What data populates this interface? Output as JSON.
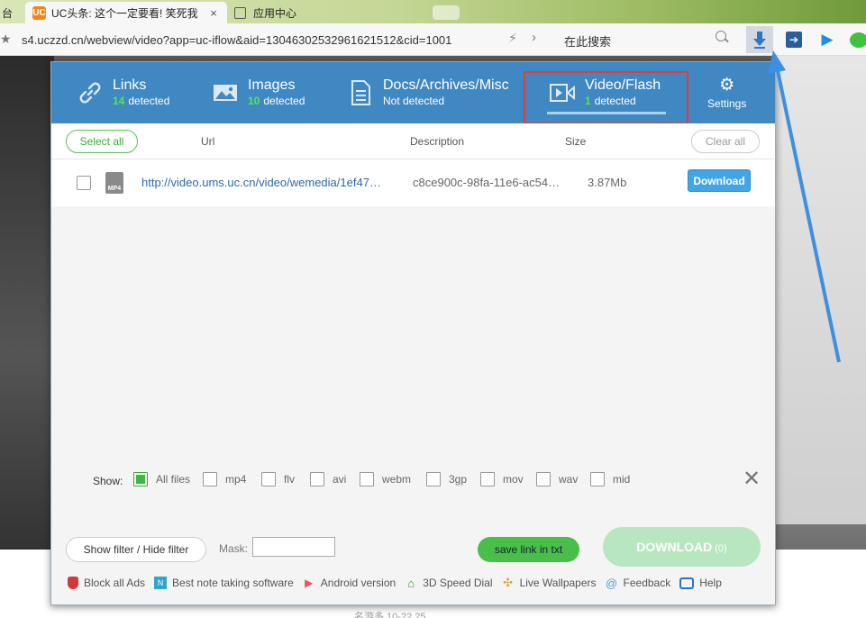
{
  "browser": {
    "tabs": [
      {
        "title": "台"
      },
      {
        "title": "UC头条: 这个一定要看! 笑死我",
        "close": "×"
      },
      {
        "title": "应用中心"
      }
    ],
    "url": "s4.uczzd.cn/webview/video?app=uc-iflow&aid=13046302532961621512&cid=1001",
    "search_placeholder": "在此搜索",
    "favicon_text": "UC"
  },
  "panel": {
    "tabs": {
      "links": {
        "label": "Links",
        "count": "14",
        "suffix": "detected"
      },
      "images": {
        "label": "Images",
        "count": "10",
        "suffix": "detected"
      },
      "docs": {
        "label": "Docs/Archives/Misc",
        "status": "Not detected"
      },
      "video": {
        "label": "Video/Flash",
        "count": "1",
        "suffix": "detected"
      },
      "settings": {
        "label": "Settings"
      }
    },
    "columns": {
      "select_all": "Select all",
      "url": "Url",
      "description": "Description",
      "size": "Size",
      "clear_all": "Clear all"
    },
    "rows": [
      {
        "type": "MP4",
        "url": "http://video.ums.uc.cn/video/wemedia/1ef47…",
        "description": "c8ce900c-98fa-11e6-ac54…",
        "size": "3.87Mb",
        "action": "Download"
      }
    ],
    "filter": {
      "show_label": "Show:",
      "options": [
        "All files",
        "mp4",
        "flv",
        "avi",
        "webm",
        "3gp",
        "mov",
        "wav",
        "mid"
      ],
      "selected": "All files"
    },
    "bottom": {
      "filter_toggle": "Show filter / Hide filter",
      "mask_label": "Mask:",
      "mask_value": "",
      "save_txt": "save link in txt",
      "download_all": "DOWNLOAD",
      "download_count": "(0)"
    },
    "footer": [
      {
        "label": "Block all Ads",
        "icon": "shield-icon"
      },
      {
        "label": "Best note taking software",
        "icon": "note-icon"
      },
      {
        "label": "Android version",
        "icon": "play-store-icon"
      },
      {
        "label": "3D Speed Dial",
        "icon": "home-icon"
      },
      {
        "label": "Live Wallpapers",
        "icon": "pinwheel-icon"
      },
      {
        "label": "Feedback",
        "icon": "at-icon"
      },
      {
        "label": "Help",
        "icon": "help-icon"
      }
    ]
  },
  "page_footer_text": "名游多 10-22 25",
  "colors": {
    "header_blue": "#3f88c2",
    "accent_green": "#49bf49",
    "count_green": "#57e457",
    "highlight_red": "#e23b3b",
    "download_blue": "#44a5e5"
  }
}
